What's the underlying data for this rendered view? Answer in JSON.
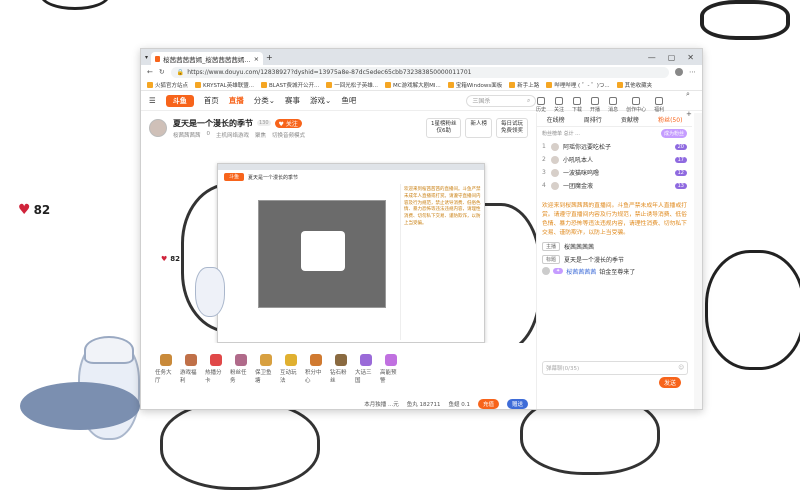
{
  "overlay": {
    "hearts": "82"
  },
  "browser": {
    "tab_title": "桜茜茜茜茜嫣_桜茜茜茜茜嫣...",
    "url": "https://www.douyu.com/12838927?dyshid=13975a8e-87dc5edec65cbb732383850000011701",
    "bookmarks": [
      "火狐官方站点",
      "KRYSTAL英雄联盟...",
      "BLAST费城开公开...",
      "一回光松子英雄...",
      "MC游戏解大剧MI...",
      "宝箱Windows面板",
      "新手上路",
      "哔哩哔哩 ( ゜- ゜)つ...",
      "其他收藏夹"
    ]
  },
  "douyu": {
    "logo": "斗鱼",
    "nav": [
      "首页",
      "直播",
      "分类",
      "赛事",
      "游戏",
      "鱼吧"
    ],
    "search_placeholder": "三国杀",
    "top_icons": [
      "历史",
      "关注",
      "下载",
      "开播",
      "消息",
      "创作中心",
      "福利"
    ],
    "stream": {
      "title": "夏天是一个漫长的季节",
      "level": "130",
      "follow": "关注",
      "streamer": "桜茜茜茜茜",
      "stats": [
        "0",
        "主机网络游戏",
        "聚焦"
      ],
      "report": "切换音频模式",
      "hbtn1": "1星榜粉丝\n仅6助",
      "hbtn2": "新人榜",
      "hbtn3": "每日试玩\n免费领奖"
    },
    "video_hearts": "82",
    "gifts": [
      {
        "name": "任务大厅",
        "color": "#c98a3a"
      },
      {
        "name": "游戏福利",
        "color": "#c07048"
      },
      {
        "name": "热播分卡",
        "color": "#e04848"
      },
      {
        "name": "粉丝任务",
        "color": "#b06a8a"
      },
      {
        "name": "保卫鱼塘",
        "color": "#d8a040"
      },
      {
        "name": "互动玩法",
        "color": "#e0b030"
      },
      {
        "name": "积分中心",
        "color": "#d07a30"
      },
      {
        "name": "钻石粉丝",
        "color": "#8a6a40"
      },
      {
        "name": "大话三国",
        "color": "#9a6ad8"
      },
      {
        "name": "高能预警",
        "color": "#c070e0"
      }
    ],
    "bottom": {
      "text1": "本月独播 ...元",
      "fish": "鱼丸 182711",
      "ball": "鱼翅 0.1",
      "btn1": "充值",
      "btn2": "赠送"
    },
    "side": {
      "tabs": [
        "在线榜",
        "周排行",
        "贡献榜",
        "粉丝(50)"
      ],
      "rank_header": "粉丝榜单 总计 ...",
      "fan_btn": "成为粉丝",
      "ranks": [
        {
          "n": "1",
          "name": "阿瑶你远要吃松子",
          "lvl": "20"
        },
        {
          "n": "2",
          "name": "小吼吼本人",
          "lvl": "17"
        },
        {
          "n": "3",
          "name": "一波猫咪呜噜",
          "lvl": "12"
        },
        {
          "n": "4",
          "name": "一团魔金液",
          "lvl": "13"
        }
      ],
      "notice": "欢迎来到桜茜茜茜的直播间。斗鱼严禁未成年人直播或打赏。请遵守直播间内容及行为规范，禁止诱导消费、低俗色情、暴力恐怖等违法违规内容，请理性消费、切勿私下交易、谨防欺诈，以防上当受骗。",
      "tag_label": "主播",
      "tag_value": "桜茜茜茜茜",
      "title_label": "标题",
      "title_value": "夏天是一个漫长的季节",
      "msg_user": "桜茜茜茜茜",
      "msg_text": "铂金至尊来了",
      "input_placeholder": "弹幕聊(0/35)",
      "send": "发送"
    }
  }
}
